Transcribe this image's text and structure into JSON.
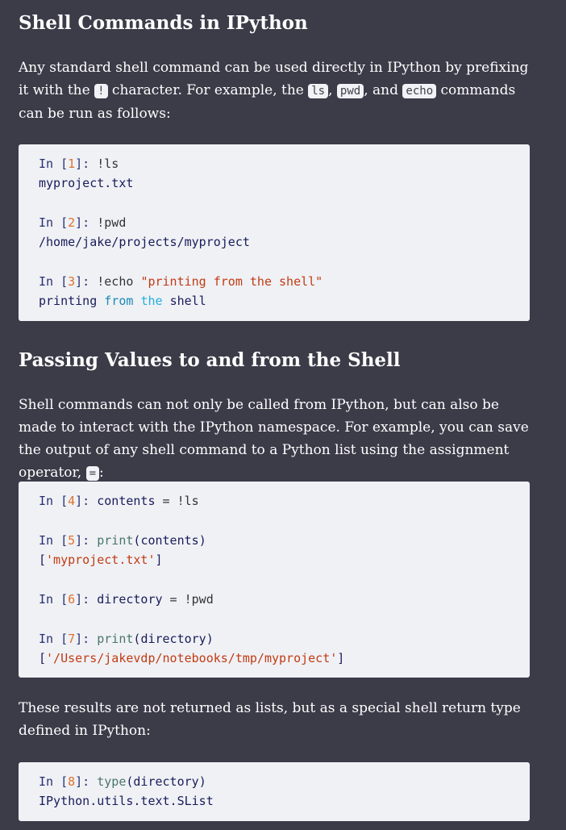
{
  "section1": {
    "title": "Shell Commands in IPython",
    "para": {
      "t1": "Any standard shell command can be used directly in IPython by prefixing it with the ",
      "c1": "!",
      "t2": " character. For example, the ",
      "c2": "ls",
      "t3": ", ",
      "c3": "pwd",
      "t4": ", and ",
      "c4": "echo",
      "t5": " commands can be run as follows:"
    }
  },
  "code1": {
    "l1": {
      "a": "In [",
      "n": "1",
      "b": "]: ",
      "c": "!ls"
    },
    "l2": "myproject.txt",
    "l3": {
      "a": "In [",
      "n": "2",
      "b": "]: ",
      "c": "!pwd"
    },
    "l4": "/home/jake/projects/myproject",
    "l5": {
      "a": "In [",
      "n": "3",
      "b": "]: ",
      "c": "!echo ",
      "s": "\"printing from the shell\""
    },
    "l6": {
      "w1": "printing",
      "w2": "from",
      "w3": "the",
      "w4": "shell"
    }
  },
  "section2": {
    "title": "Passing Values to and from the Shell",
    "para": {
      "t1": "Shell commands can not only be called from IPython, but can also be made to in­teract with the IPython namespace. For example, you can save the output of any shell command to a Python list using the assignment operator, ",
      "c1": "=",
      "t2": ":"
    }
  },
  "code2": {
    "l1": {
      "a": "In [",
      "n": "4",
      "b": "]: ",
      "v": "contents",
      "op": " = ",
      "c": "!ls"
    },
    "l2": {
      "a": "In [",
      "n": "5",
      "b": "]: ",
      "f": "print",
      "p1": "(",
      "v": "contents",
      "p2": ")"
    },
    "l3": {
      "a": "[",
      "s": "'myproject.txt'",
      "b": "]"
    },
    "l4": {
      "a": "In [",
      "n": "6",
      "b": "]: ",
      "v": "directory",
      "op": " = ",
      "c": "!pwd"
    },
    "l5": {
      "a": "In [",
      "n": "7",
      "b": "]: ",
      "f": "print",
      "p1": "(",
      "v": "directory",
      "p2": ")"
    },
    "l6": {
      "a": "[",
      "s": "'/Users/jakevdp/notebooks/tmp/myproject'",
      "b": "]"
    }
  },
  "para3": "These results are not returned as lists, but as a special shell return type defined in IPython:",
  "code3": {
    "l1": {
      "a": "In [",
      "n": "8",
      "b": "]: ",
      "f": "type",
      "p1": "(",
      "v": "directory",
      "p2": ")"
    },
    "l2": "IPython.utils.text.SList"
  }
}
